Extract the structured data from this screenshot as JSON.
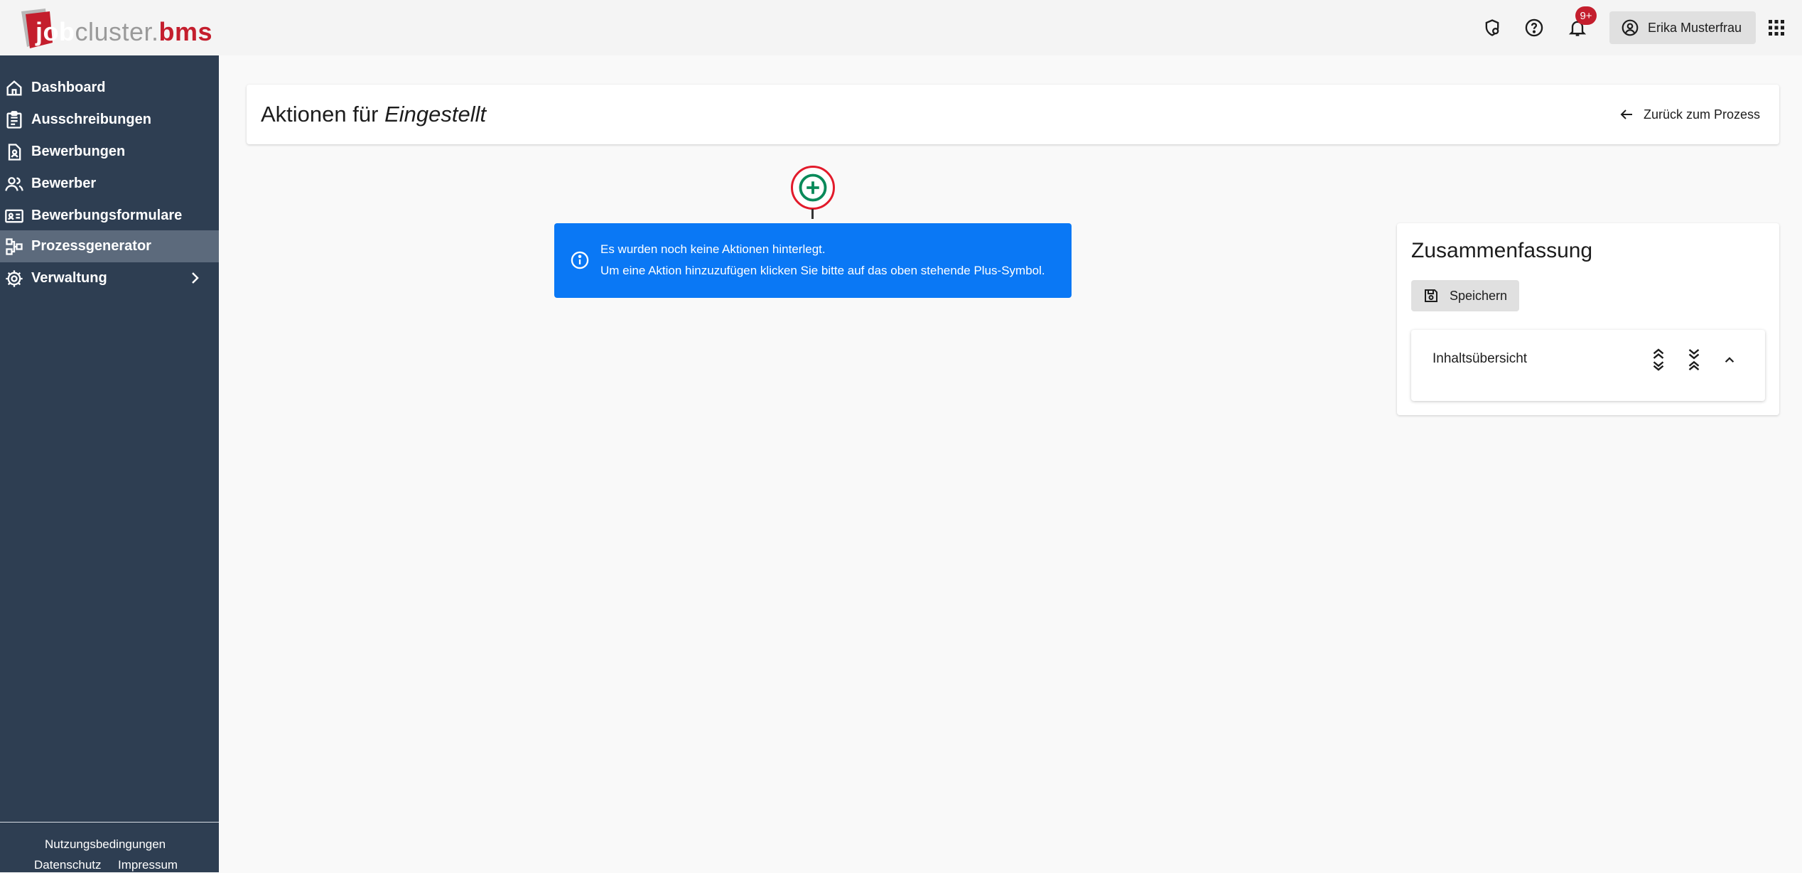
{
  "header": {
    "logo": {
      "job": "job",
      "cluster": "cluster",
      "dot": ".",
      "bms": "bms"
    },
    "icons": [
      "shield-settings-icon",
      "help-icon",
      "bell-icon",
      "apps-grid-icon"
    ],
    "notification_badge": "9+",
    "user_name": "Erika Musterfrau",
    "colors": {
      "badge": "#c41e2d",
      "brand_red": "#c41e2d"
    }
  },
  "sidebar": {
    "items": [
      {
        "label": "Dashboard",
        "icon": "home-icon"
      },
      {
        "label": "Ausschreibungen",
        "icon": "clipboard-icon"
      },
      {
        "label": "Bewerbungen",
        "icon": "document-person-icon"
      },
      {
        "label": "Bewerber",
        "icon": "people-icon"
      },
      {
        "label": "Bewerbungsformulare",
        "icon": "id-card-icon"
      },
      {
        "label": "Prozessgenerator",
        "icon": "flowchart-icon",
        "active": true
      },
      {
        "label": "Verwaltung",
        "icon": "gear-icon",
        "has_submenu": true
      }
    ],
    "footer": {
      "terms": "Nutzungsbedingungen",
      "privacy": "Datenschutz",
      "imprint": "Impressum"
    },
    "colors": {
      "background": "#2e3e52",
      "active": "#5c6a7c"
    }
  },
  "main": {
    "title_prefix": "Aktionen für",
    "title_emphasis": "Eingestellt",
    "back_label": "Zurück zum Prozess",
    "info": {
      "line1": "Es wurden noch keine Aktionen hinterlegt.",
      "line2": "Um eine Aktion hinzuzufügen klicken Sie bitte auf das oben stehende Plus-Symbol.",
      "color": "#0a78f5"
    },
    "add_button": {
      "icon": "plus-circle-icon",
      "color": "#0a8a5a",
      "ring": "#e21b2b"
    }
  },
  "summary": {
    "title": "Zusammenfassung",
    "save_label": "Speichern",
    "toc_title": "Inhaltsübersicht",
    "toc_icons": [
      "expand-all-icon",
      "collapse-all-icon",
      "chevron-up-icon"
    ]
  }
}
